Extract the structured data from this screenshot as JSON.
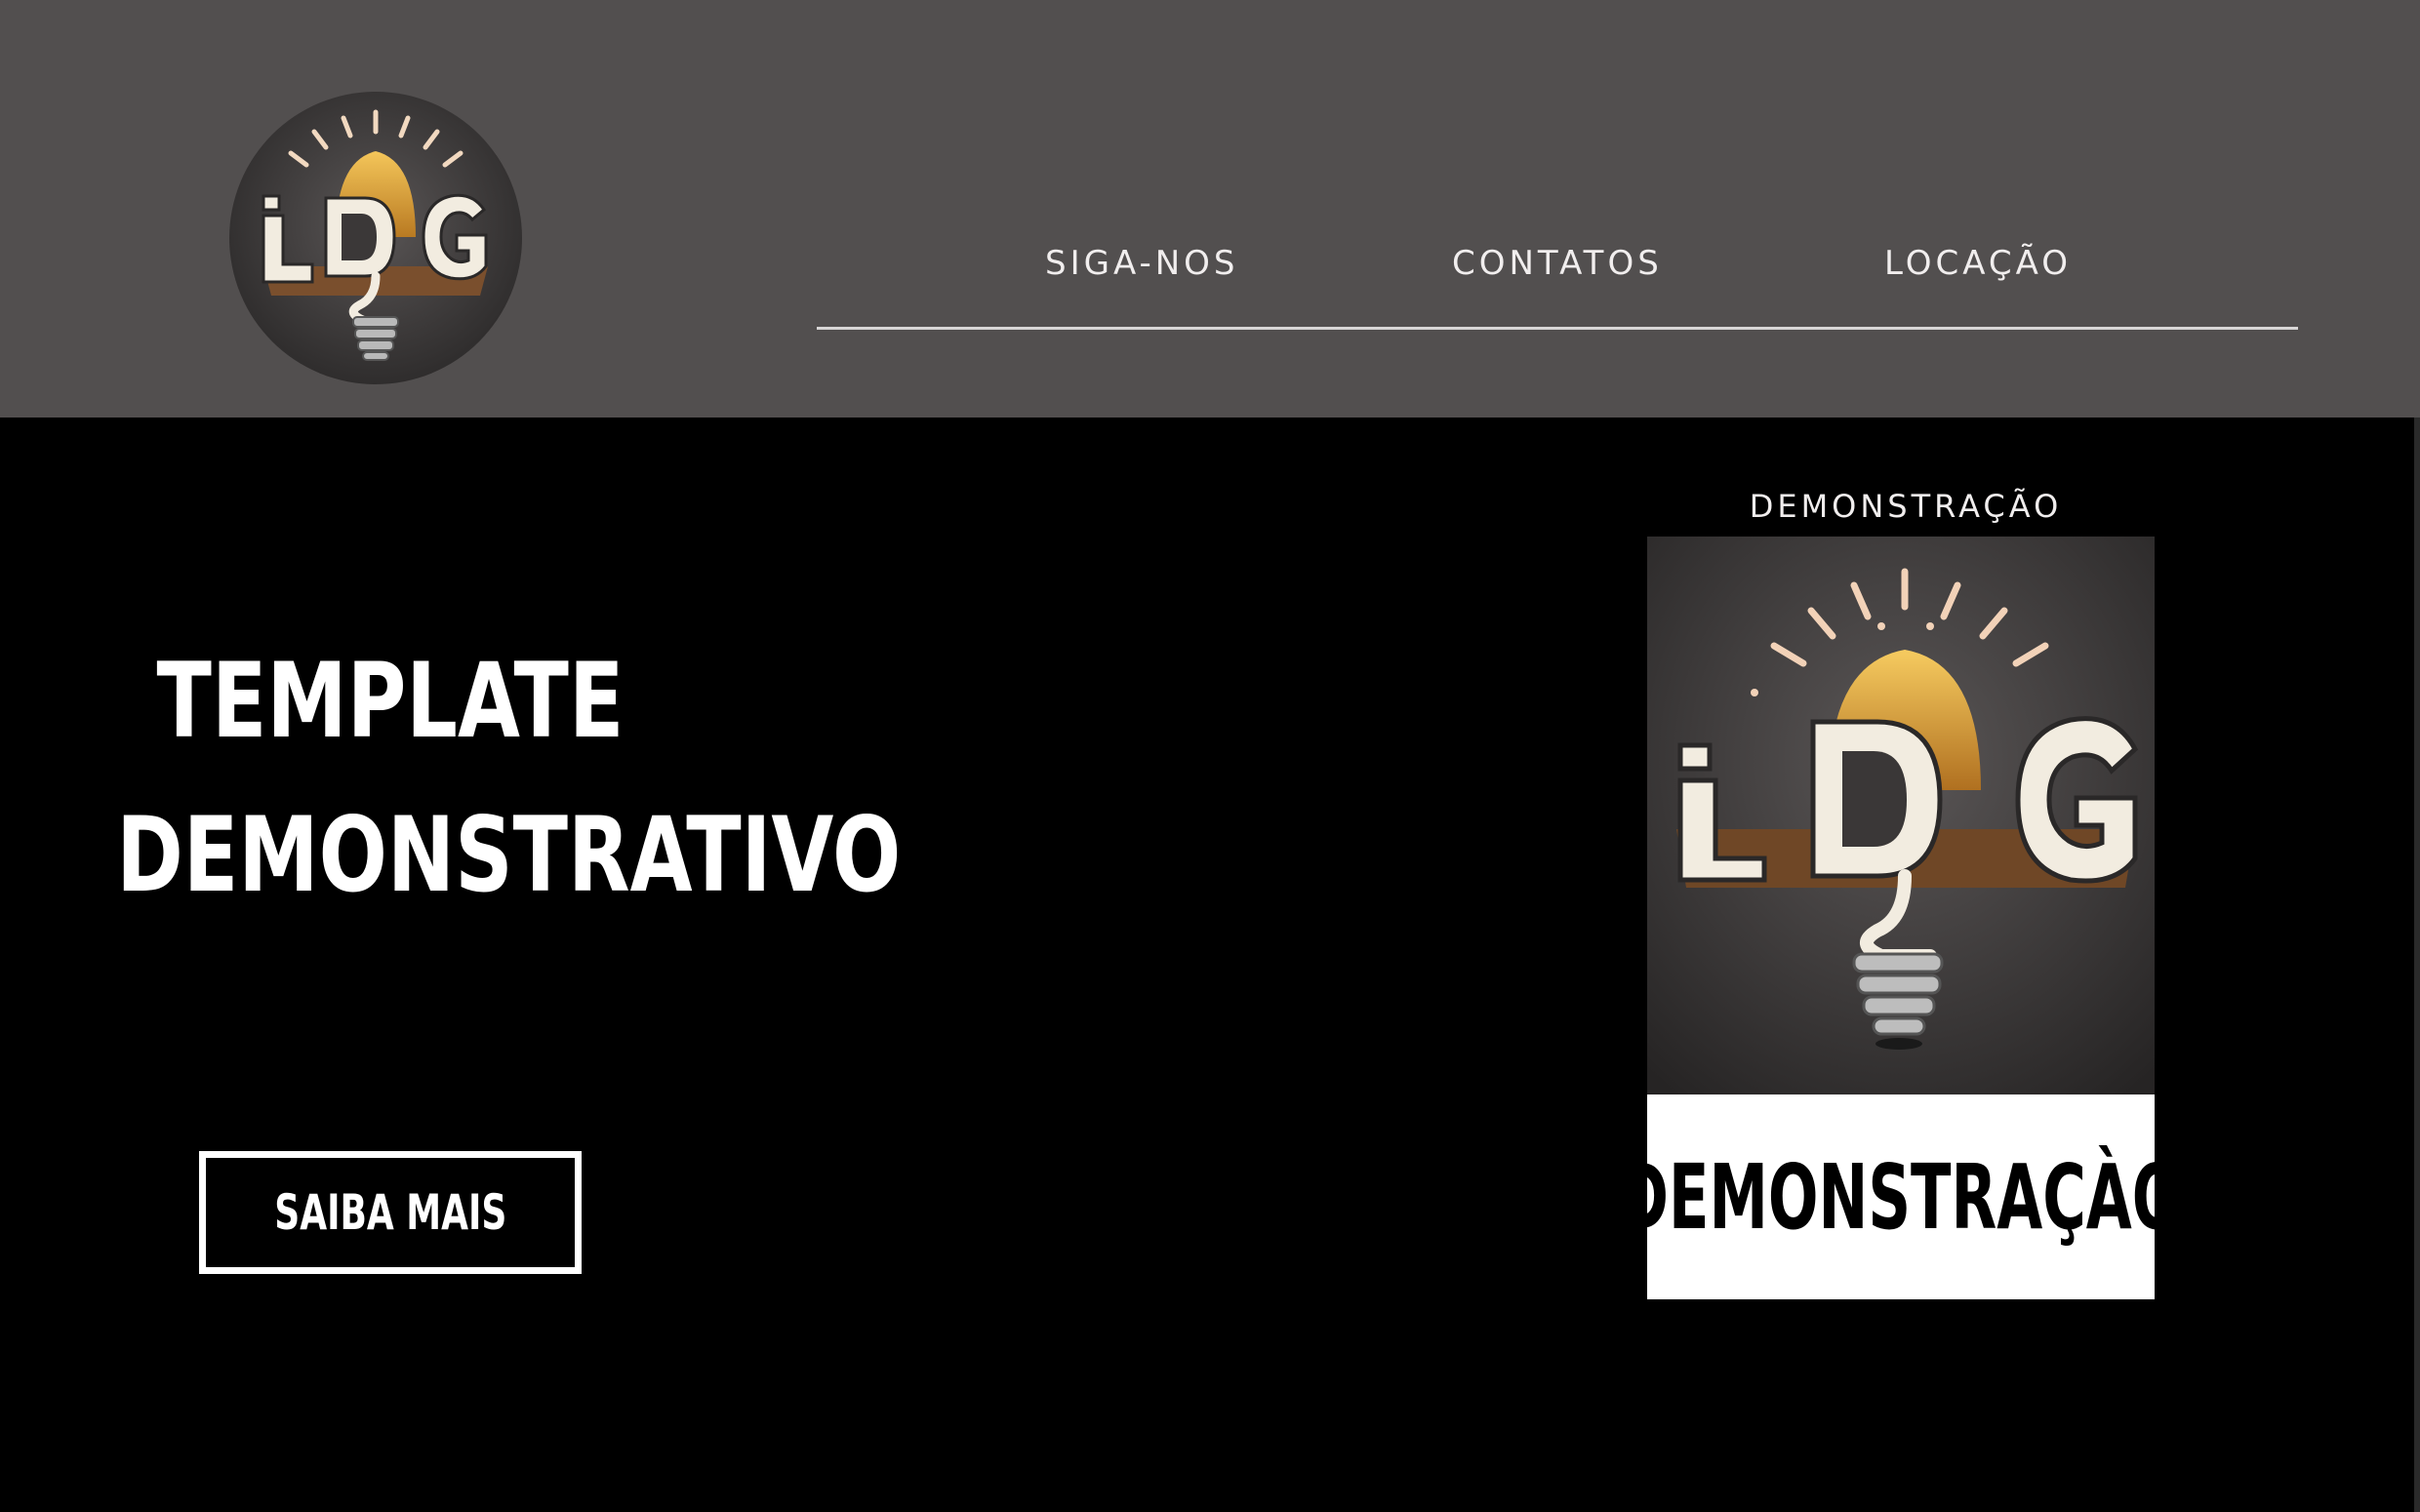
{
  "header": {
    "logo": {
      "icon": "lightbulb-ldg-logo",
      "text": "LDG"
    },
    "nav": [
      {
        "label": "SIGA-NOS"
      },
      {
        "label": "CONTATOS"
      },
      {
        "label": "LOCAÇÃO"
      }
    ]
  },
  "hero": {
    "title_line1": "TEMPLATE",
    "title_line2": "DEMONSTRATIVO",
    "cta_label": "SAIBA MAIS"
  },
  "demo_card": {
    "caption": "DEMONSTRAÇÃO",
    "image_icon": "lightbulb-ldg-logo",
    "image_text": "LDG",
    "label": "DEMONSTRAÇÀO"
  },
  "colors": {
    "header_bg": "#524f4f",
    "page_bg": "#000000",
    "accent_gold": "#e8a93c",
    "cream": "#f2ece0"
  }
}
